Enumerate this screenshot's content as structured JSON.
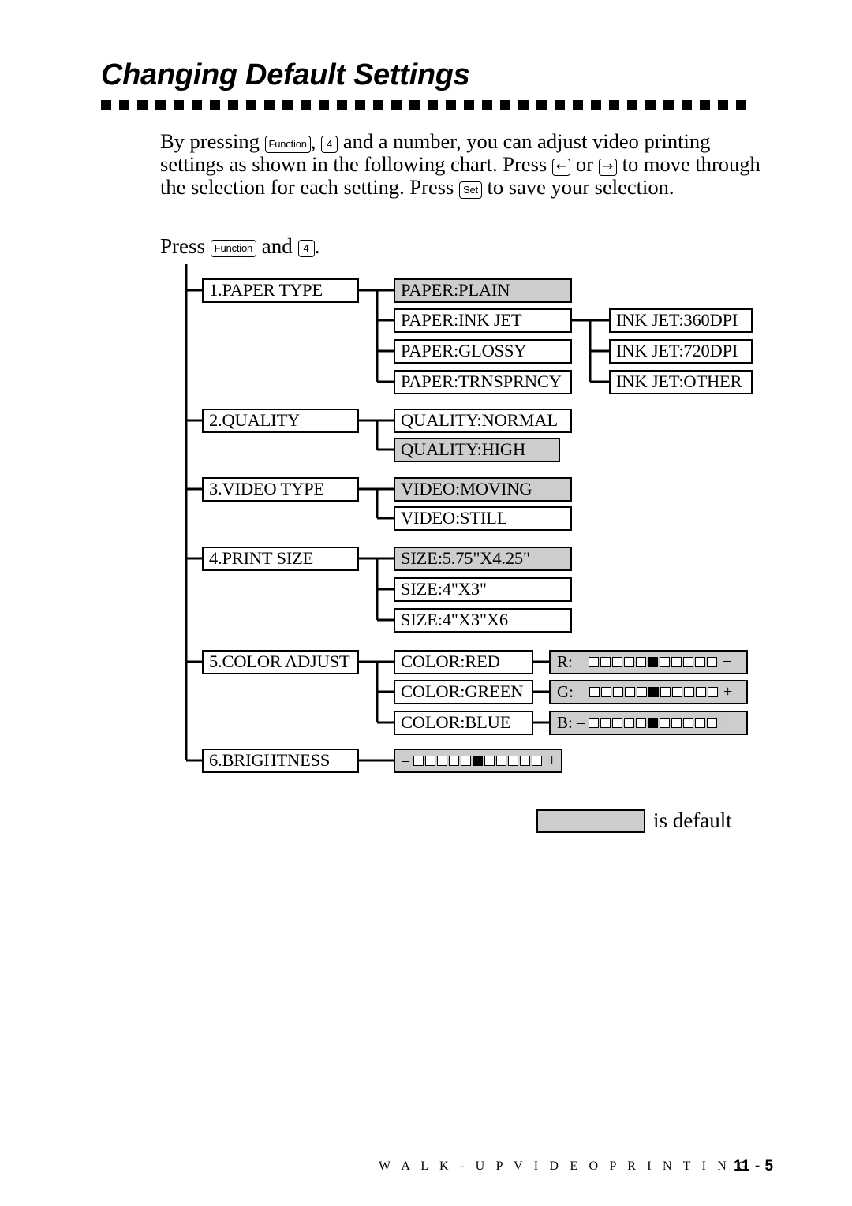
{
  "header": {
    "title": "Changing Default Settings"
  },
  "intro": {
    "line1_a": "By  pressing ",
    "key_function": "Function",
    "line1_b": ", ",
    "key_4": "4",
    "line1_c": " and a number, you can adjust video printing",
    "line2_a": "settings as shown in the following chart. Press ",
    "key_left": "←",
    "line2_b": " or ",
    "key_right": "→",
    "line2_c": " to move through",
    "line3_a": "the selection for each setting. Press ",
    "key_set": "Set",
    "line3_b": " to save your selection."
  },
  "press_line": {
    "prefix": "Press ",
    "key_function": "Function",
    "middle": " and ",
    "key_4": "4",
    "suffix": "."
  },
  "menu": {
    "items": [
      {
        "label": "1.PAPER TYPE",
        "options": [
          {
            "label": "PAPER:PLAIN",
            "default": true
          },
          {
            "label": "PAPER:INK JET",
            "default": false,
            "sub": [
              {
                "label": "INK JET:360DPI",
                "default": false
              },
              {
                "label": "INK JET:720DPI",
                "default": false
              },
              {
                "label": "INK JET:OTHER",
                "default": false
              }
            ]
          },
          {
            "label": "PAPER:GLOSSY",
            "default": false
          },
          {
            "label": "PAPER:TRNSPRNCY",
            "default": false
          }
        ]
      },
      {
        "label": "2.QUALITY",
        "options": [
          {
            "label": "QUALITY:NORMAL",
            "default": false
          },
          {
            "label": "QUALITY:HIGH",
            "default": true
          }
        ]
      },
      {
        "label": "3.VIDEO TYPE",
        "options": [
          {
            "label": "VIDEO:MOVING",
            "default": true
          },
          {
            "label": "VIDEO:STILL",
            "default": false
          }
        ]
      },
      {
        "label": "4.PRINT SIZE",
        "options": [
          {
            "label": "SIZE:5.75\"X4.25\"",
            "default": true
          },
          {
            "label": "SIZE:4\"X3\"",
            "default": false
          },
          {
            "label": "SIZE:4\"X3\"X6",
            "default": false
          }
        ]
      },
      {
        "label": "5.COLOR ADJUST",
        "options": [
          {
            "label": "COLOR:RED",
            "default": false,
            "slider": {
              "prefix": "R:",
              "minus": "–",
              "plus": "+",
              "cells": 11,
              "filled_index": 5
            }
          },
          {
            "label": "COLOR:GREEN",
            "default": false,
            "slider": {
              "prefix": "G:",
              "minus": "–",
              "plus": "+",
              "cells": 11,
              "filled_index": 5
            }
          },
          {
            "label": "COLOR:BLUE",
            "default": false,
            "slider": {
              "prefix": "B:",
              "minus": "–",
              "plus": "+",
              "cells": 11,
              "filled_index": 5
            }
          }
        ]
      },
      {
        "label": "6.BRIGHTNESS",
        "slider": {
          "prefix": "",
          "minus": "–",
          "plus": "+",
          "cells": 11,
          "filled_index": 5
        }
      }
    ]
  },
  "legend": {
    "text": "is default"
  },
  "footer": {
    "section": "W A L K - U P   V I D E O   P R I N T I N G",
    "page": "11 - 5"
  }
}
